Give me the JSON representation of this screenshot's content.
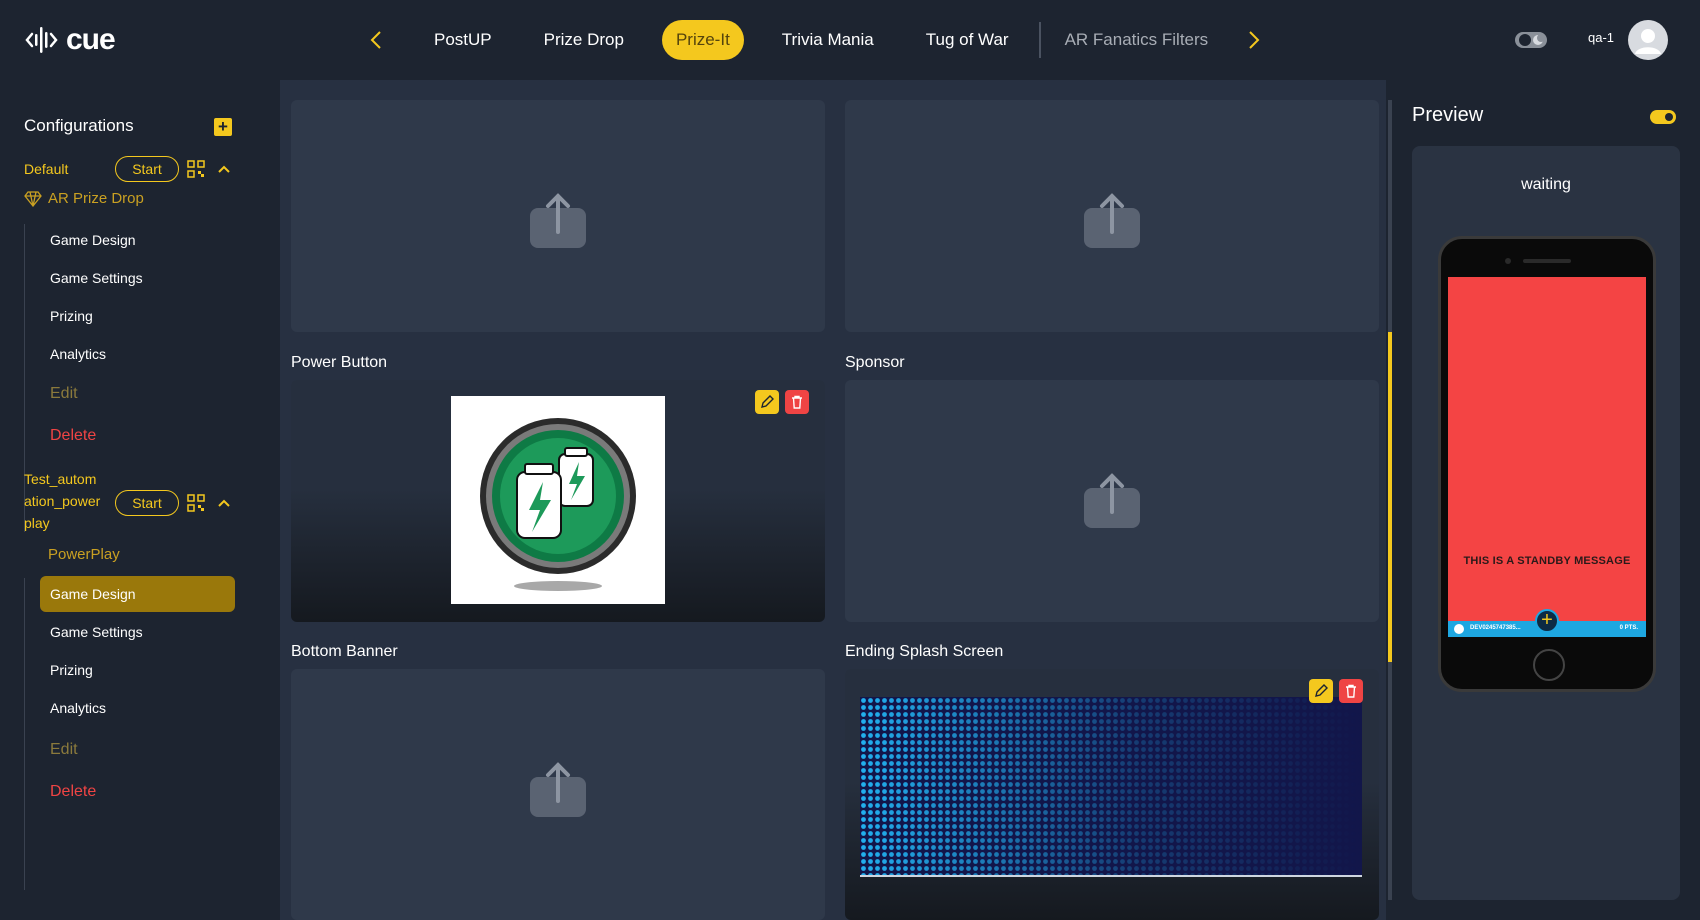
{
  "app": {
    "logo_text": "cue"
  },
  "nav": {
    "tabs": [
      {
        "label": "PostUP"
      },
      {
        "label": "Prize Drop"
      },
      {
        "label": "Prize-It"
      },
      {
        "label": "Trivia Mania"
      },
      {
        "label": "Tug of War"
      },
      {
        "label": "AR Fanatics Filters"
      }
    ],
    "active_tab": "Prize-It"
  },
  "user": {
    "name": "qa-1"
  },
  "sidebar": {
    "title": "Configurations",
    "configs": [
      {
        "name": "Default",
        "start_label": "Start",
        "game": "AR Prize Drop",
        "items": [
          "Game Design",
          "Game Settings",
          "Prizing",
          "Analytics",
          "Edit",
          "Delete"
        ]
      },
      {
        "name_lines": [
          "Test_autom",
          "ation_power",
          "play"
        ],
        "start_label": "Start",
        "game": "PowerPlay",
        "items": [
          "Game Design",
          "Game Settings",
          "Prizing",
          "Analytics",
          "Edit",
          "Delete"
        ],
        "active_item": "Game Design"
      }
    ]
  },
  "main": {
    "assets": [
      {
        "label": "Power Button"
      },
      {
        "label": "Sponsor"
      },
      {
        "label": "Bottom Banner"
      },
      {
        "label": "Ending Splash Screen"
      }
    ]
  },
  "preview": {
    "title": "Preview",
    "status": "waiting",
    "standby_message": "THIS IS A STANDBY MESSAGE",
    "bar_id": "DEV0245747385...",
    "bar_points": "0 PTS."
  },
  "colors": {
    "accent": "#f4c81e",
    "danger": "#ef4444",
    "background": "#1d2430",
    "panel": "#273041",
    "phone_screen": "#f44444"
  }
}
